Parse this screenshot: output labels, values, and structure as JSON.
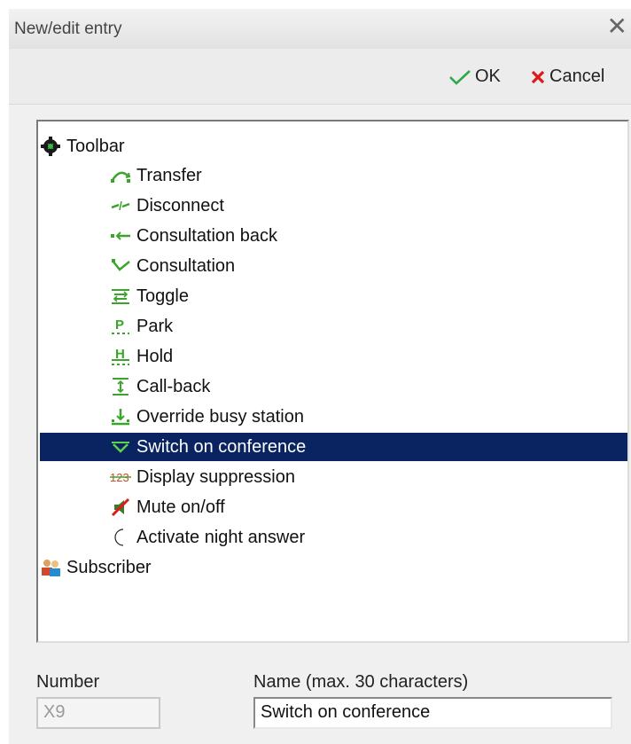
{
  "window": {
    "title": "New/edit entry",
    "close_glyph": "✕"
  },
  "actions": {
    "ok_label": "OK",
    "cancel_label": "Cancel"
  },
  "tree": {
    "root": {
      "label": "Toolbar",
      "icon": "toolbar-gear-icon"
    },
    "items": [
      {
        "label": "Transfer",
        "icon": "transfer-icon"
      },
      {
        "label": "Disconnect",
        "icon": "disconnect-icon"
      },
      {
        "label": "Consultation back",
        "icon": "consultation-back-icon"
      },
      {
        "label": "Consultation",
        "icon": "consultation-icon"
      },
      {
        "label": "Toggle",
        "icon": "toggle-icon"
      },
      {
        "label": "Park",
        "icon": "park-icon"
      },
      {
        "label": "Hold",
        "icon": "hold-icon"
      },
      {
        "label": "Call-back",
        "icon": "call-back-icon"
      },
      {
        "label": "Override busy station",
        "icon": "override-icon"
      },
      {
        "label": "Switch on conference",
        "icon": "conference-icon",
        "selected": true
      },
      {
        "label": "Display suppression",
        "icon": "display-suppression-icon"
      },
      {
        "label": "Mute on/off",
        "icon": "mute-icon"
      },
      {
        "label": "Activate night answer",
        "icon": "night-answer-icon"
      }
    ],
    "root2": {
      "label": "Subscriber",
      "icon": "subscriber-icon"
    }
  },
  "form": {
    "number_label": "Number",
    "number_value": "X9",
    "name_label": "Name (max. 30 characters)",
    "name_value": "Switch on conference"
  },
  "colors": {
    "selection": "#0a2461",
    "icon_green": "#3aa52a",
    "ok_green": "#2ea84a",
    "cancel_red": "#e01818"
  }
}
